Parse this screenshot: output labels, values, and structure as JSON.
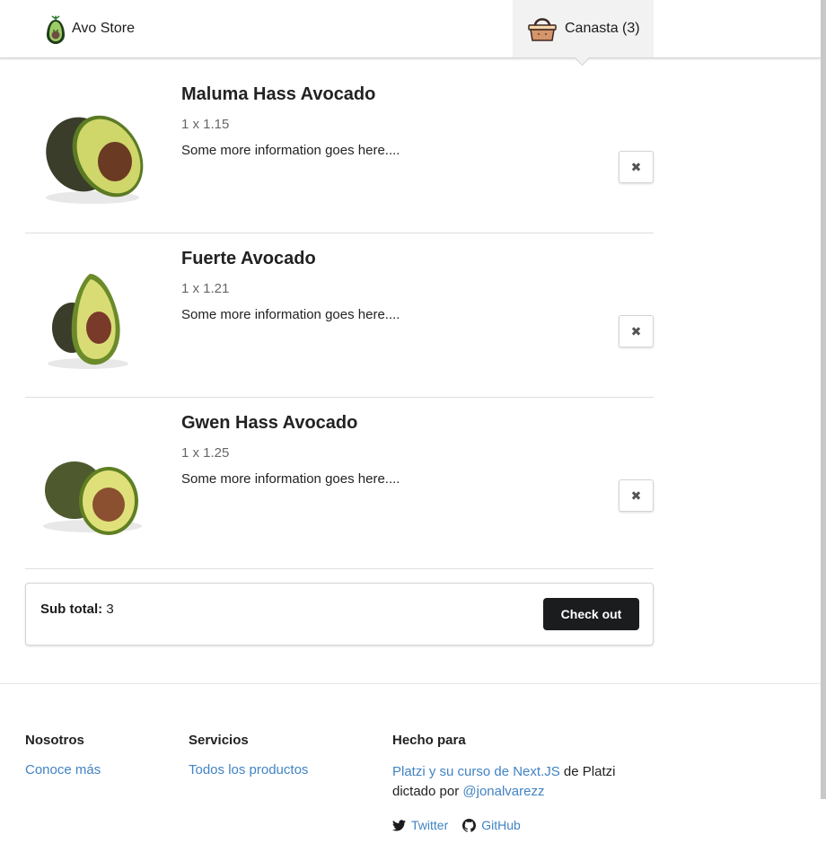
{
  "header": {
    "brand": "Avo Store",
    "cart_label": "Canasta (3)"
  },
  "cart": {
    "items": [
      {
        "name": "Maluma Hass Avocado",
        "qty": "1 x 1.15",
        "desc": "Some more information goes here....",
        "remove_icon": "close-icon"
      },
      {
        "name": "Fuerte Avocado",
        "qty": "1 x 1.21",
        "desc": "Some more information goes here....",
        "remove_icon": "close-icon"
      },
      {
        "name": "Gwen Hass Avocado",
        "qty": "1 x 1.25",
        "desc": "Some more information goes here....",
        "remove_icon": "close-icon"
      }
    ],
    "subtotal_label": "Sub total:",
    "subtotal_value": " 3",
    "checkout_label": "Check out"
  },
  "footer": {
    "col1": {
      "title": "Nosotros",
      "link": "Conoce más"
    },
    "col2": {
      "title": "Servicios",
      "link": "Todos los productos"
    },
    "col3": {
      "title": "Hecho para",
      "link1": "Platzi y su curso de Next.JS",
      "text1": " de Platzi",
      "text2": "dictado por ",
      "link2": "@jonalvarezz",
      "twitter": "Twitter",
      "github": "GitHub"
    }
  },
  "colors": {
    "link": "#4183c4",
    "button": "#1b1c1d",
    "tab_bg": "#f2f2f2"
  }
}
